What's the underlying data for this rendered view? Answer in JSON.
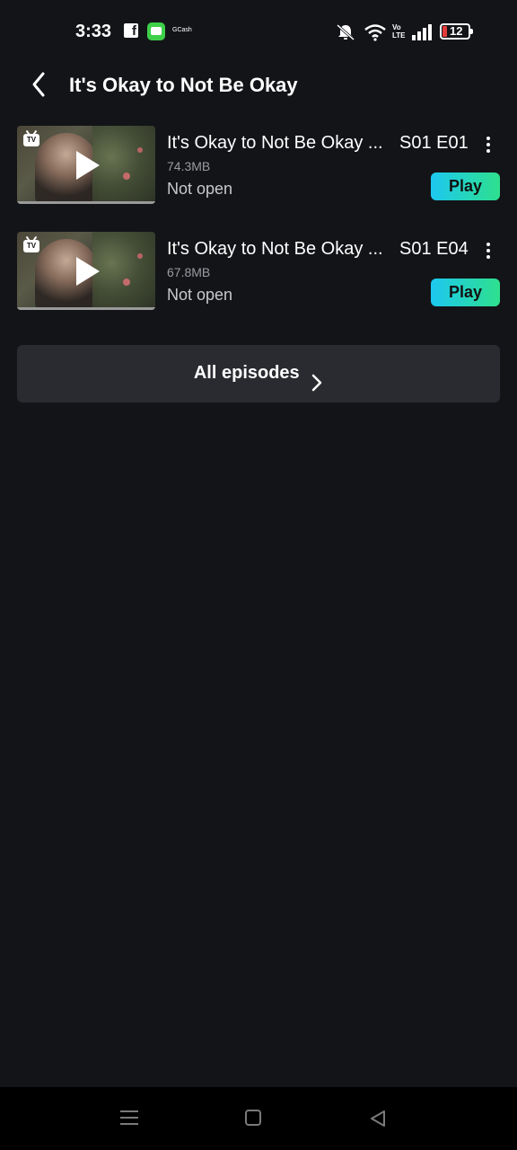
{
  "status_bar": {
    "time": "3:33",
    "fb_label": "f",
    "gcash_label": "GCash",
    "volte_label": "Vo LTE",
    "battery_level": "12"
  },
  "header": {
    "title": "It's Okay to Not Be Okay"
  },
  "episodes": [
    {
      "title": "It's Okay to Not Be Okay ...",
      "code": "S01 E01",
      "size": "74.3MB",
      "status": "Not open",
      "play_label": "Play",
      "badge": "TV"
    },
    {
      "title": "It's Okay to Not Be Okay ...",
      "code": "S01 E04",
      "size": "67.8MB",
      "status": "Not open",
      "play_label": "Play",
      "badge": "TV"
    }
  ],
  "all_episodes": {
    "label": "All episodes"
  },
  "colors": {
    "background": "#131418",
    "play_gradient_start": "#1cc8f0",
    "play_gradient_end": "#2ee08d",
    "card": "#2a2b30"
  }
}
